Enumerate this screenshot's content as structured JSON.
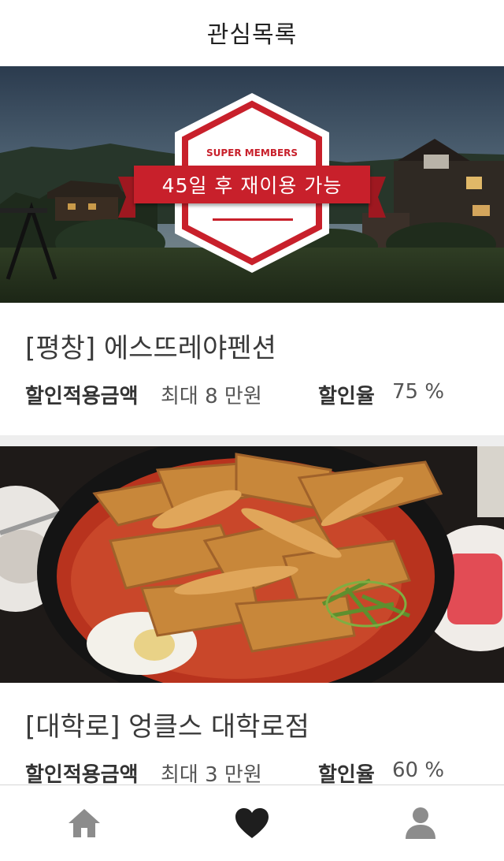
{
  "header": {
    "title": "관심목록"
  },
  "cards": [
    {
      "image": "pension-night-photo",
      "badge": {
        "label": "SUPER MEMBERS",
        "text": "45일 후 재이용 가능"
      },
      "title": "[평창] 에스뜨레야펜션",
      "discount_amount_label": "할인적용금액",
      "discount_amount_value": "최대 8 만원",
      "discount_rate_label": "할인율",
      "discount_rate_value": "75 %"
    },
    {
      "image": "tteokbokki-tempura-photo",
      "title": "[대학로] 엉클스 대학로점",
      "discount_amount_label": "할인적용금액",
      "discount_amount_value": "최대 3 만원",
      "discount_rate_label": "할인율",
      "discount_rate_value": "60 %"
    }
  ],
  "bottom_nav": {
    "items": [
      {
        "icon": "home-icon",
        "active": false
      },
      {
        "icon": "heart-icon",
        "active": true
      },
      {
        "icon": "user-icon",
        "active": false
      }
    ]
  },
  "colors": {
    "brand_red": "#c8202b",
    "active_icon": "#1e1e1e",
    "inactive_icon": "#8c8c8c",
    "divider": "#eeeeee"
  }
}
